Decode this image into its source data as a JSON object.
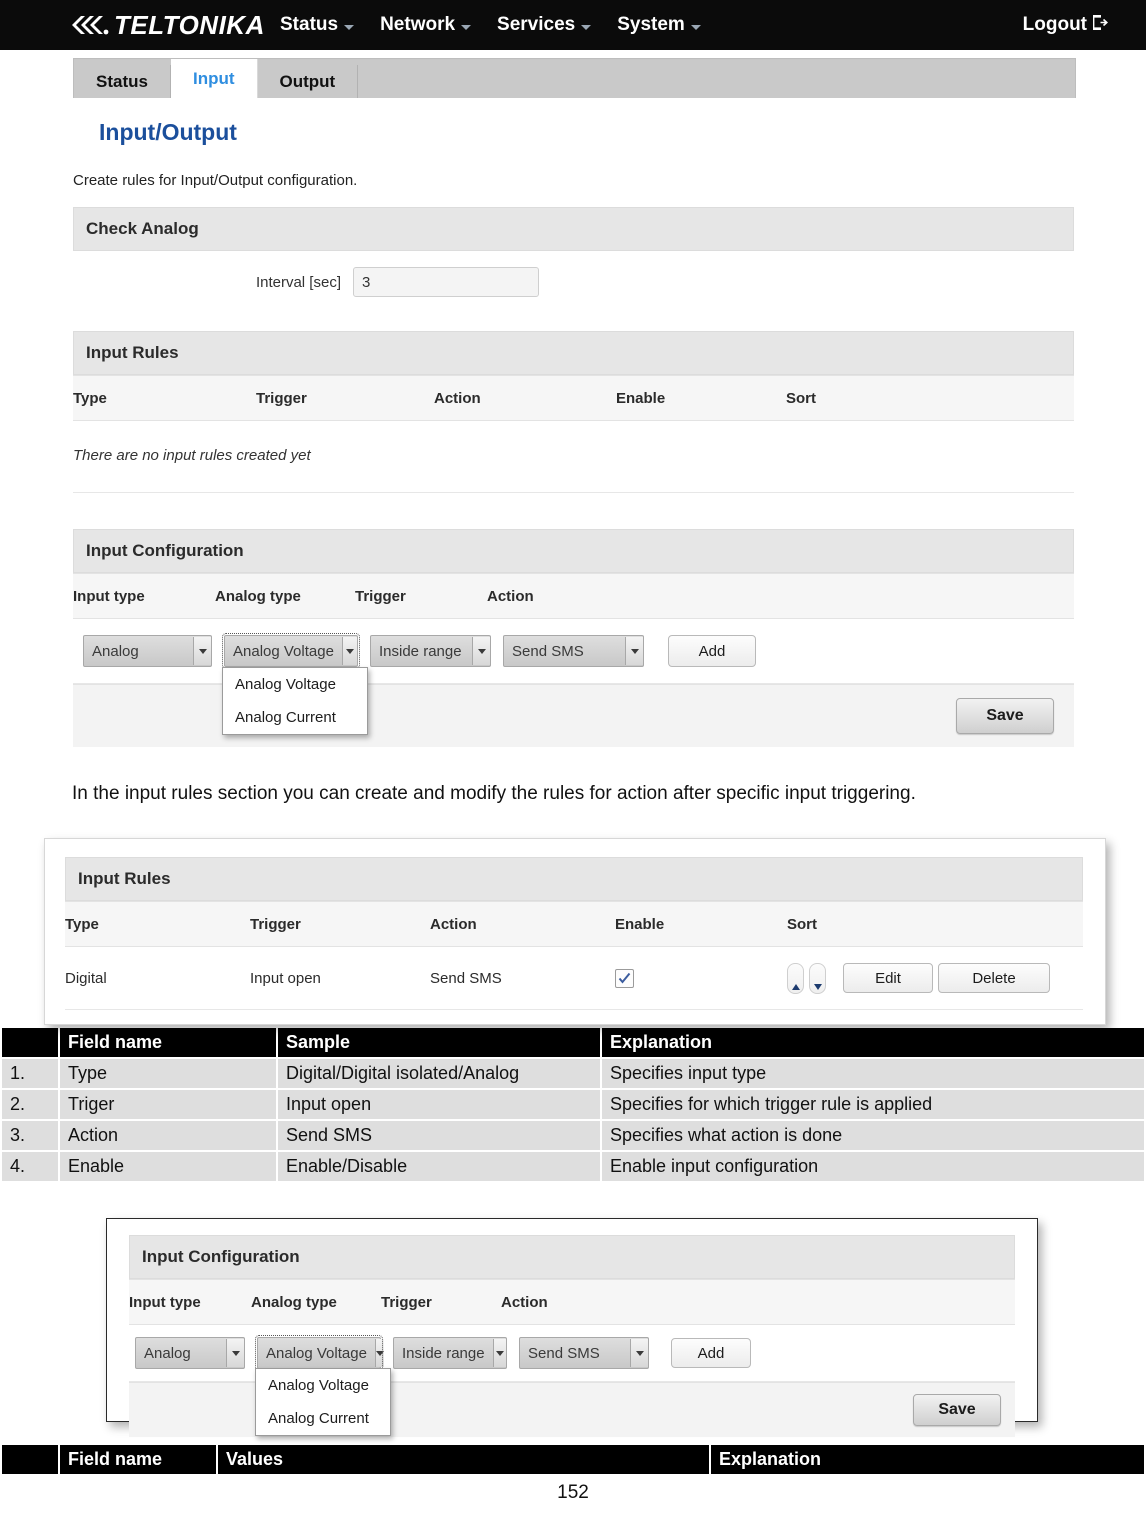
{
  "navbar": {
    "brand": "TELTONIKA",
    "menu": [
      {
        "label": "Status"
      },
      {
        "label": "Network"
      },
      {
        "label": "Services"
      },
      {
        "label": "System"
      }
    ],
    "logout": "Logout"
  },
  "tabs": [
    {
      "label": "Status",
      "active": false
    },
    {
      "label": "Input",
      "active": true
    },
    {
      "label": "Output",
      "active": false
    }
  ],
  "page": {
    "title": "Input/Output",
    "description": "Create rules for Input/Output configuration."
  },
  "check_analog": {
    "section_title": "Check Analog",
    "interval_label": "Interval [sec]",
    "interval_value": "3"
  },
  "input_rules_empty": {
    "section_title": "Input Rules",
    "columns": [
      "Type",
      "Trigger",
      "Action",
      "Enable",
      "Sort"
    ],
    "empty_message": "There are no input rules created yet"
  },
  "input_configuration": {
    "section_title": "Input Configuration",
    "columns": [
      "Input type",
      "Analog type",
      "Trigger",
      "Action"
    ],
    "input_type_value": "Analog",
    "analog_type_value": "Analog Voltage",
    "analog_type_options": [
      "Analog Voltage",
      "Analog Current"
    ],
    "trigger_value": "Inside range",
    "action_value": "Send SMS",
    "add_label": "Add",
    "save_label": "Save"
  },
  "body_text": {
    "paragraph": "In the input rules section you can create and modify the rules for action after specific input triggering."
  },
  "input_rules_filled": {
    "section_title": "Input Rules",
    "columns": [
      "Type",
      "Trigger",
      "Action",
      "Enable",
      "Sort"
    ],
    "row": {
      "type": "Digital",
      "trigger": "Input open",
      "action": "Send SMS",
      "enabled": true,
      "edit_label": "Edit",
      "delete_label": "Delete"
    }
  },
  "table_fields": {
    "headers": [
      "",
      "Field name",
      "Sample",
      "Explanation"
    ],
    "rows": [
      {
        "num": "1.",
        "field": "Type",
        "sample": "Digital/Digital isolated/Analog",
        "explanation": "Specifies input type"
      },
      {
        "num": "2.",
        "field": "Triger",
        "sample": "Input open",
        "explanation": "Specifies for which trigger rule is applied"
      },
      {
        "num": "3.",
        "field": "Action",
        "sample": "Send SMS",
        "explanation": "Specifies what action is done"
      },
      {
        "num": "4.",
        "field": "Enable",
        "sample": "Enable/Disable",
        "explanation": "Enable input configuration"
      }
    ]
  },
  "table_values_header": {
    "headers": [
      "",
      "Field name",
      "Values",
      "Explanation"
    ]
  },
  "footer": {
    "page_number": "152"
  },
  "colors": {
    "navbar_bg": "#0b0b0b",
    "accent_blue": "#2f8ee0",
    "title_blue": "#1b4f9c",
    "section_bg": "#e6e6e6",
    "table_cell_bg": "#dedede"
  }
}
